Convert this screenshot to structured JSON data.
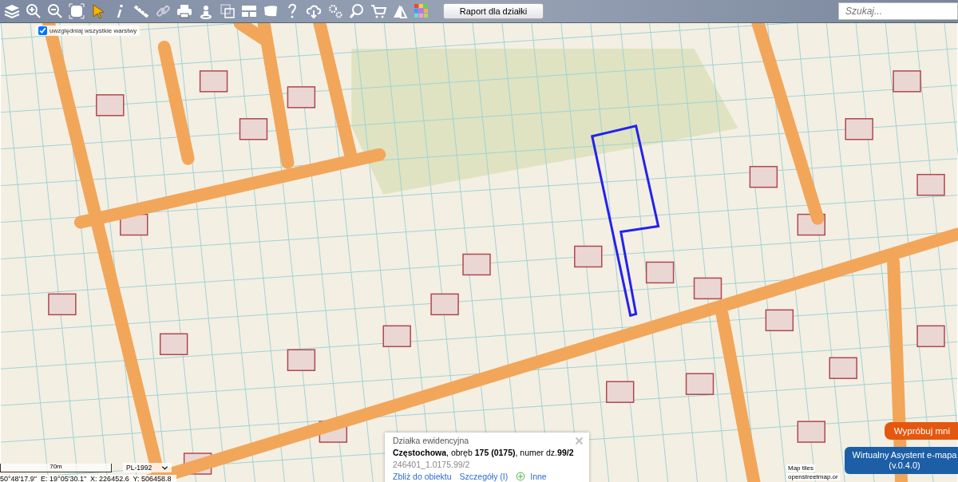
{
  "toolbar": {
    "report_button": "Raport dla działki",
    "search": {
      "placeholder": "Szukaj..."
    }
  },
  "layers_option": {
    "label": "uwzględniaj wszystkie warstwy",
    "checked": true
  },
  "popup": {
    "title": "Działka ewidencyjna",
    "description": "**Częstochowa**, obręb **175 (0175)**, numer dz.**99/2**",
    "identifier": "246401_1.0175.99/2",
    "links": [
      {
        "kind": "link",
        "label": "Zbliż do obiektu"
      },
      {
        "kind": "link",
        "label": "Szczegóły (I)"
      },
      {
        "kind": "add",
        "label": "Inne"
      }
    ]
  },
  "scale": {
    "label": "70m"
  },
  "projection": {
    "value": "PL-1992"
  },
  "coordinates": "50°48'17.9\"  E: 19°05'30.1\"  X: 226452.6  Y: 506458.8",
  "attribution": [
    "Map tiles",
    "openstreetmap.or"
  ],
  "try_button": "Wypróbuj mni",
  "assistant_button": {
    "title": "Wirtualny Asystent e-mapa",
    "version": "(v.0.4.0)"
  }
}
